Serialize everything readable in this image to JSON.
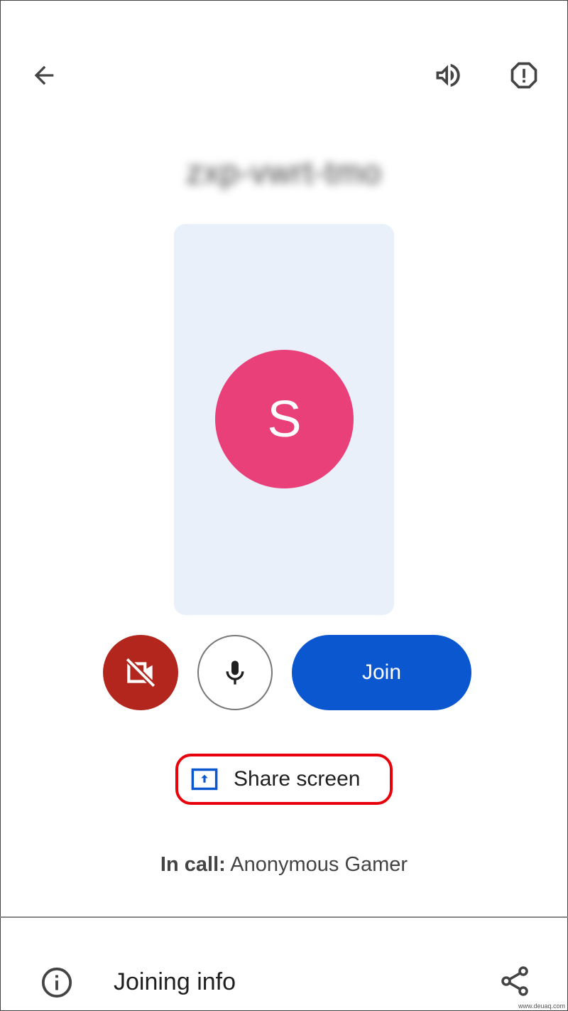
{
  "header": {
    "back_icon": "arrow-back-icon",
    "audio_icon": "speaker-icon",
    "report_icon": "report-octagon-icon"
  },
  "meeting_code": "zxp-vwrt-tmo",
  "preview": {
    "avatar_initial": "S",
    "avatar_color": "#e9407a",
    "background": "#e9f0fa"
  },
  "controls": {
    "camera_icon": "videocam-off-icon",
    "camera_color": "#b3261e",
    "mic_icon": "mic-icon",
    "join_label": "Join",
    "join_color": "#0b57d0"
  },
  "share": {
    "icon": "screen-share-icon",
    "label": "Share screen",
    "highlight_color": "#e8000b"
  },
  "in_call": {
    "prefix": "In call:",
    "names": "Anonymous Gamer"
  },
  "footer": {
    "info_icon": "info-icon",
    "label": "Joining info",
    "share_icon": "share-icon"
  },
  "watermark": "www.deuaq.com"
}
